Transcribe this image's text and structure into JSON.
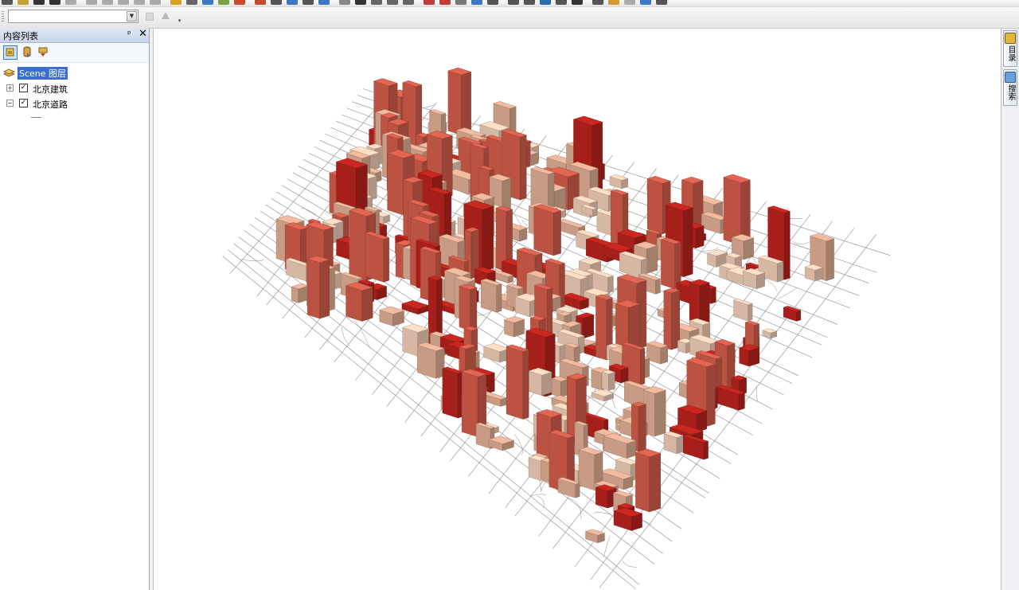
{
  "toolbar": {
    "combo_value": "",
    "overflow_glyph": "▾"
  },
  "toc": {
    "title": "内容列表",
    "pin_glyph": "ᵖ",
    "close_glyph": "✕",
    "tools": [
      "list-by-drawing-order-icon",
      "list-by-source-icon",
      "list-by-visibility-icon"
    ],
    "scene_group": "Scene 图层",
    "layers": [
      {
        "name": "北京建筑",
        "checked": true,
        "expanded": false,
        "expander": "+"
      },
      {
        "name": "北京道路",
        "checked": true,
        "expanded": true,
        "expander": "−"
      }
    ],
    "check_glyph": "✓"
  },
  "right_dock": {
    "tabs": [
      {
        "label": "目录",
        "icon": "catalog-icon"
      },
      {
        "label": "搜索",
        "icon": "search-window-icon"
      }
    ]
  },
  "scene": {
    "layers_rendered": [
      "北京建筑",
      "北京道路"
    ],
    "colors": {
      "building_dark": "#b5221c",
      "building_mid": "#cc5a48",
      "building_light": "#d9a88f",
      "building_pale": "#e8c7b1",
      "road": "#8a8a8a",
      "background": "#ffffff"
    }
  }
}
